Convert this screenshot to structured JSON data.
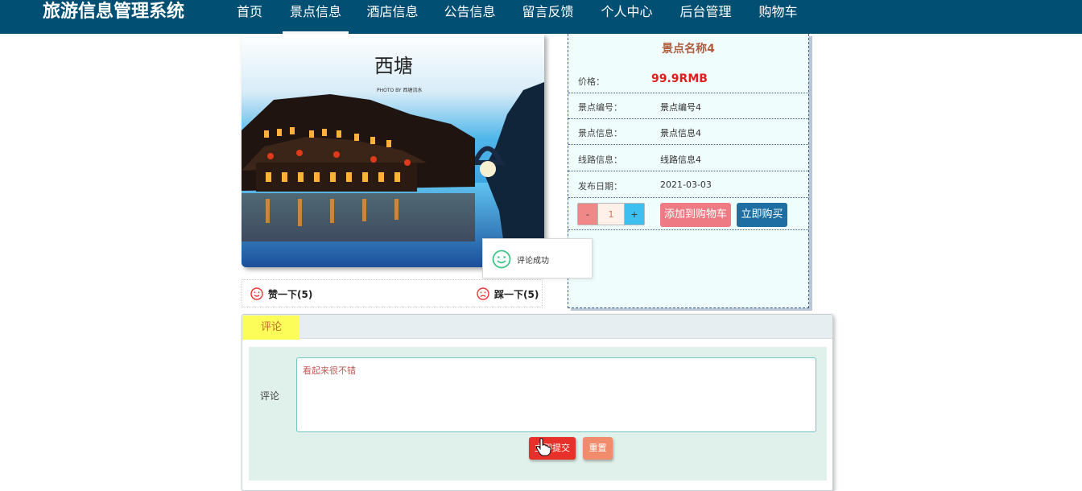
{
  "header": {
    "brand": "旅游信息管理系统",
    "nav": [
      {
        "label": "首页",
        "active": false
      },
      {
        "label": "景点信息",
        "active": true
      },
      {
        "label": "酒店信息",
        "active": false
      },
      {
        "label": "公告信息",
        "active": false
      },
      {
        "label": "留言反馈",
        "active": false
      },
      {
        "label": "个人中心",
        "active": false
      },
      {
        "label": "后台管理",
        "active": false
      },
      {
        "label": "购物车",
        "active": false
      }
    ]
  },
  "photo": {
    "caption_line1": "西塘",
    "caption_line2": "PHOTO BY 西塘流水"
  },
  "votes": {
    "like": "赞一下(5)",
    "dislike": "踩一下(5)"
  },
  "detail": {
    "title": "景点名称4",
    "price_label": "价格：",
    "price_value": "99.9RMB",
    "rows": [
      {
        "label": "景点编号：",
        "value": "景点编号4"
      },
      {
        "label": "景点信息：",
        "value": "景点信息4"
      },
      {
        "label": "线路信息：",
        "value": "线路信息4"
      },
      {
        "label": "发布日期：",
        "value": "2021-03-03"
      }
    ],
    "quantity": {
      "minus": "-",
      "value": "1",
      "plus": "+"
    },
    "add_to_cart": "添加到购物车",
    "buy_now": "立即购买"
  },
  "toast": {
    "text": "评论成功"
  },
  "comments": {
    "tab": "评论",
    "field_label": "评论",
    "field_value": "看起来很不错",
    "submit": "立即提交",
    "reset": "重置"
  },
  "colors": {
    "header_bg": "#024f74",
    "price": "#e0201e",
    "tab_bg": "#fdfd5a",
    "submit": "#e8302b"
  }
}
